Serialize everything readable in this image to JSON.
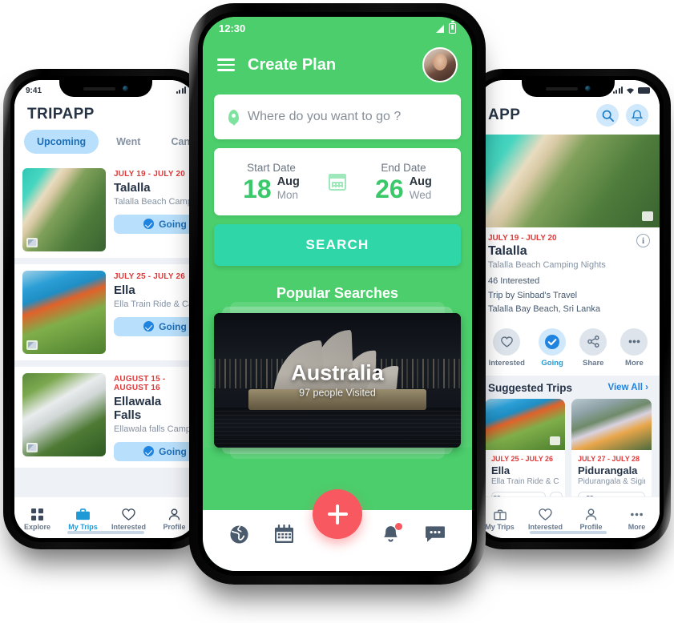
{
  "left_phone": {
    "status": {
      "time": "9:41"
    },
    "app_title": "TRIPAPP",
    "tabs": [
      {
        "label": "Upcoming",
        "active": true
      },
      {
        "label": "Went",
        "active": false
      },
      {
        "label": "Cancelled",
        "active": false
      }
    ],
    "trips": [
      {
        "date": "JULY 19 - JULY 20",
        "name": "Talalla",
        "desc": "Talalla Beach Camping Nights",
        "button": "Going",
        "image": "beach-aerial-thumbnail"
      },
      {
        "date": "JULY 25 - JULY 26",
        "name": "Ella",
        "desc": "Ella Train Ride & Camping Nights",
        "button": "Going",
        "image": "train-woman-thumbnail"
      },
      {
        "date": "AUGUST 15 - AUGUST 16",
        "name": "Ellawala Falls",
        "desc": "Ellawala falls Camping Nights",
        "button": "Going",
        "image": "waterfall-thumbnail"
      }
    ],
    "nav": [
      {
        "label": "Explore",
        "icon": "grid-icon",
        "active": false
      },
      {
        "label": "My Trips",
        "icon": "briefcase-icon",
        "active": true
      },
      {
        "label": "Interested",
        "icon": "heart-icon",
        "active": false
      },
      {
        "label": "Profile",
        "icon": "person-icon",
        "active": false
      }
    ]
  },
  "center_phone": {
    "status": {
      "time": "12:30",
      "signal": "signal-icon",
      "battery": "battery-icon"
    },
    "header": {
      "menu": "hamburger-icon",
      "title": "Create Plan",
      "avatar": "user-avatar"
    },
    "search": {
      "placeholder": "Where do you want to go ?",
      "icon": "location-pin-icon"
    },
    "dates": {
      "start": {
        "label": "Start Date",
        "day": "18",
        "month": "Aug",
        "weekday": "Mon"
      },
      "end": {
        "label": "End Date",
        "day": "26",
        "month": "Aug",
        "weekday": "Wed"
      },
      "calendar_icon": "calendar-icon"
    },
    "search_button": "SEARCH",
    "popular": {
      "title": "Popular Searches",
      "card": {
        "name": "Australia",
        "meta": "97 people Visited",
        "image": "sydney-opera-house-night"
      }
    },
    "nav": [
      {
        "icon": "globe-icon",
        "label": ""
      },
      {
        "icon": "calendar-icon",
        "label": ""
      },
      {
        "icon": "plus-icon",
        "label": "",
        "fab": true
      },
      {
        "icon": "bell-icon",
        "label": "",
        "badge": true
      },
      {
        "icon": "chat-icon",
        "label": ""
      }
    ],
    "colors": {
      "header_green": "#4BCE6B",
      "search_button_teal": "#2ED6A8",
      "fab_red": "#F8585F",
      "date_number_green": "#39C96A"
    }
  },
  "right_phone": {
    "app_title": "APP",
    "header_icons": [
      {
        "name": "search-icon"
      },
      {
        "name": "bell-icon"
      }
    ],
    "hero_image": "talalla-beach-aerial",
    "detail": {
      "date": "JULY 19 - JULY 20",
      "name": "Talalla",
      "desc": "Talalla Beach Camping Nights",
      "interested_count": "46 Interested",
      "operator": "Trip by Sinbad's Travel",
      "location": "Talalla Bay Beach, Sri Lanka",
      "info_icon": "info-icon"
    },
    "actions": [
      {
        "label": "Interested",
        "icon": "heart-icon",
        "active": false
      },
      {
        "label": "Going",
        "icon": "check-circle-icon",
        "active": true
      },
      {
        "label": "Share",
        "icon": "share-icon",
        "active": false
      },
      {
        "label": "More",
        "icon": "more-dots-icon",
        "active": false
      }
    ],
    "suggested": {
      "title": "Suggested Trips",
      "view_all": "View All",
      "cards": [
        {
          "date": "JULY 25 - JULY 26",
          "name": "Ella",
          "desc": "Ella Train Ride & Camping",
          "button": "Interested",
          "more": "more-dots-icon",
          "image": "blue-train-tea-fields"
        },
        {
          "date": "JULY 27 - JULY 28",
          "name": "Pidurangala",
          "desc": "Pidurangala & Sigiriya",
          "button": "Interested",
          "image": "pidurangala-rock-woman"
        }
      ]
    },
    "nav": [
      {
        "label": "My Trips",
        "icon": "briefcase-icon"
      },
      {
        "label": "Interested",
        "icon": "heart-icon"
      },
      {
        "label": "Profile",
        "icon": "person-icon"
      },
      {
        "label": "More",
        "icon": "more-dots-icon"
      }
    ]
  }
}
